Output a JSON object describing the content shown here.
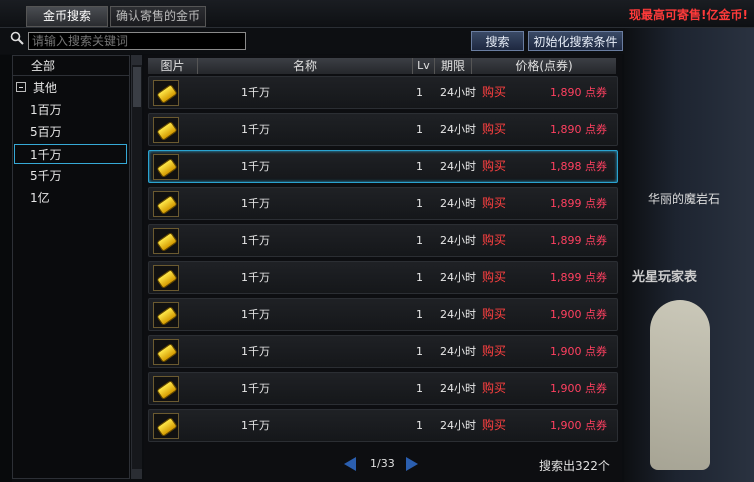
{
  "tabs": [
    {
      "label": "金币搜索"
    },
    {
      "label": "确认寄售的金币"
    }
  ],
  "notice": "现最高可寄售!亿金币!",
  "search": {
    "placeholder": "请输入搜索关键词"
  },
  "buttons": {
    "search": "搜索",
    "reset": "初始化搜索条件"
  },
  "sidebar": {
    "all": "全部",
    "group": "其他",
    "items": [
      {
        "label": "1百万"
      },
      {
        "label": "5百万"
      },
      {
        "label": "1千万"
      },
      {
        "label": "5千万"
      },
      {
        "label": "1亿"
      }
    ],
    "selected": "1千万"
  },
  "table": {
    "headers": {
      "image": "图片",
      "name": "名称",
      "lv": "Lv",
      "period": "期限",
      "price": "价格(点券)"
    },
    "rows": [
      {
        "name": "1千万",
        "lv": "1",
        "period": "24小时",
        "buy": "购买",
        "price": "1,890 点券"
      },
      {
        "name": "1千万",
        "lv": "1",
        "period": "24小时",
        "buy": "购买",
        "price": "1,890 点券"
      },
      {
        "name": "1千万",
        "lv": "1",
        "period": "24小时",
        "buy": "购买",
        "price": "1,898 点券"
      },
      {
        "name": "1千万",
        "lv": "1",
        "period": "24小时",
        "buy": "购买",
        "price": "1,899 点券"
      },
      {
        "name": "1千万",
        "lv": "1",
        "period": "24小时",
        "buy": "购买",
        "price": "1,899 点券"
      },
      {
        "name": "1千万",
        "lv": "1",
        "period": "24小时",
        "buy": "购买",
        "price": "1,899 点券"
      },
      {
        "name": "1千万",
        "lv": "1",
        "period": "24小时",
        "buy": "购买",
        "price": "1,900 点券"
      },
      {
        "name": "1千万",
        "lv": "1",
        "period": "24小时",
        "buy": "购买",
        "price": "1,900 点券"
      },
      {
        "name": "1千万",
        "lv": "1",
        "period": "24小时",
        "buy": "购买",
        "price": "1,900 点券"
      },
      {
        "name": "1千万",
        "lv": "1",
        "period": "24小时",
        "buy": "购买",
        "price": "1,900 点券"
      }
    ],
    "selected_row": 3
  },
  "pager": {
    "text": "1/33"
  },
  "result_count": "搜索出322个",
  "background": {
    "label1": "华丽的魔岩石",
    "label2": "光星玩家表"
  },
  "colors": {
    "price": "#ff4060",
    "buy": "#ff4040",
    "notice": "#ff3a3a",
    "selection": "#2aa3d0"
  },
  "icons": {
    "search": "search-icon",
    "coin": "gold-coin-icon",
    "prev": "prev-page-arrow-icon",
    "next": "next-page-arrow-icon"
  }
}
